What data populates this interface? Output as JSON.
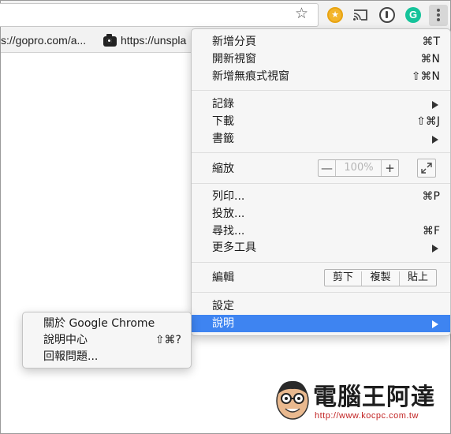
{
  "toolbar": {
    "bookmark_star": "☆",
    "ext_star": "★",
    "ext_g": "G"
  },
  "bookmarks": [
    {
      "text": "s://gopro.com/a..."
    },
    {
      "text": "https://unspla"
    }
  ],
  "menu": {
    "new_tab": {
      "label": "新增分頁",
      "shortcut": "⌘T"
    },
    "new_window": {
      "label": "開新視窗",
      "shortcut": "⌘N"
    },
    "incognito": {
      "label": "新增無痕式視窗",
      "shortcut": "⇧⌘N"
    },
    "history": {
      "label": "記錄"
    },
    "downloads": {
      "label": "下載",
      "shortcut": "⇧⌘J"
    },
    "bookmarks": {
      "label": "書籤"
    },
    "zoom": {
      "label": "縮放",
      "minus": "—",
      "value": "100%",
      "plus": "+"
    },
    "print": {
      "label": "列印...",
      "shortcut": "⌘P"
    },
    "cast": {
      "label": "投放..."
    },
    "find": {
      "label": "尋找...",
      "shortcut": "⌘F"
    },
    "more_tools": {
      "label": "更多工具"
    },
    "edit": {
      "label": "編輯",
      "cut": "剪下",
      "copy": "複製",
      "paste": "貼上"
    },
    "settings": {
      "label": "設定"
    },
    "help": {
      "label": "說明"
    }
  },
  "help_submenu": {
    "about": {
      "label": "關於 Google Chrome"
    },
    "help_center": {
      "label": "說明中心",
      "shortcut": "⇧⌘?"
    },
    "report": {
      "label": "回報問題..."
    }
  },
  "watermark": {
    "title": "電腦王阿達",
    "url": "http://www.kocpc.com.tw"
  },
  "colors": {
    "highlight": "#3e84f1",
    "menu_bg": "#f6f6f6",
    "toolbar_bg": "#f2f2f2"
  }
}
